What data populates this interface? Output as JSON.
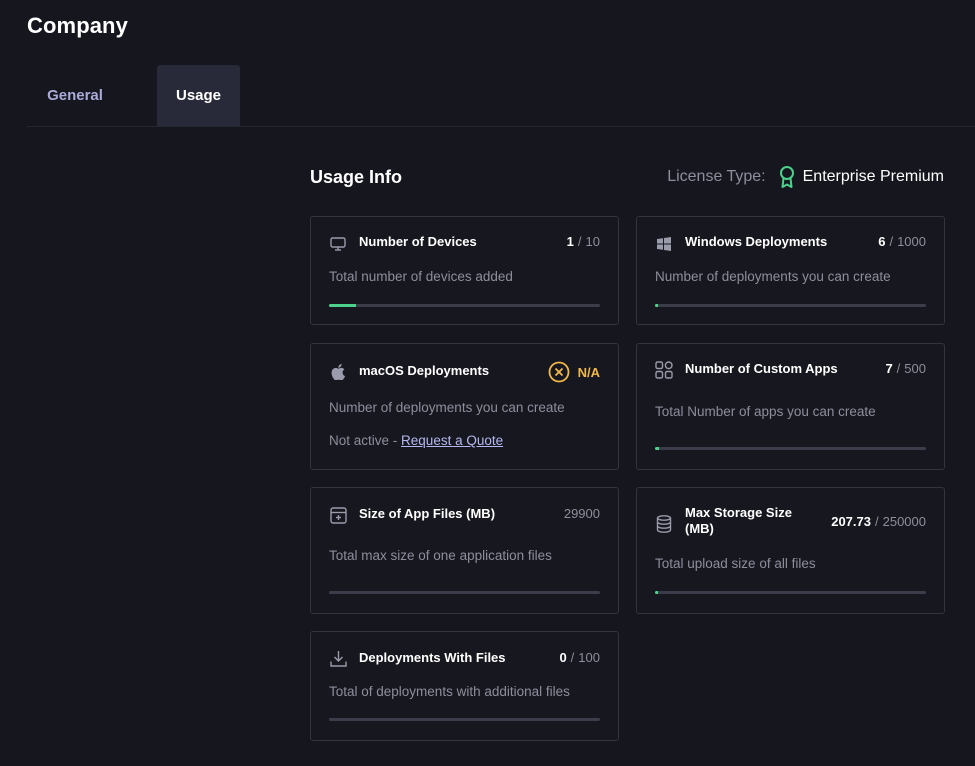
{
  "page": {
    "title": "Company"
  },
  "tabs": [
    {
      "label": "General",
      "active": false
    },
    {
      "label": "Usage",
      "active": true
    }
  ],
  "usage": {
    "title": "Usage Info",
    "license_label": "License Type:",
    "license_value": "Enterprise Premium",
    "license_icon": "award-ribbon-icon"
  },
  "colors": {
    "accent_green": "#4cd28a",
    "warning_amber": "#f1b84a",
    "link": "#b5b8f0"
  },
  "cards": {
    "devices": {
      "title": "Number of Devices",
      "used": "1",
      "sep": "/",
      "limit": "10",
      "desc": "Total number of devices added",
      "progress": 0.1,
      "icon": "monitor-icon"
    },
    "windows": {
      "title": "Windows Deployments",
      "used": "6",
      "sep": "/",
      "limit": "1000",
      "desc": "Number of deployments you can create",
      "progress": 0.006,
      "icon": "windows-icon"
    },
    "macos": {
      "title": "macOS Deployments",
      "status": "N/A",
      "desc": "Number of deployments you can create",
      "not_active": "Not active -",
      "quote_link": "Request a Quote",
      "icon": "apple-icon"
    },
    "custom_apps": {
      "title": "Number of Custom Apps",
      "used": "7",
      "sep": "/",
      "limit": "500",
      "desc": "Total Number of apps you can create",
      "progress": 0.014,
      "icon": "apps-grid-icon"
    },
    "app_files": {
      "title": "Size of App Files (MB)",
      "limit": "29900",
      "desc": "Total max size of one application files",
      "progress": 0,
      "icon": "package-icon"
    },
    "storage": {
      "title": "Max Storage Size (MB)",
      "used": "207.73",
      "sep": "/",
      "limit": "250000",
      "desc": "Total upload size of all files",
      "progress": 0.0008,
      "icon": "database-icon"
    },
    "deploy_files": {
      "title": "Deployments With Files",
      "used": "0",
      "sep": "/",
      "limit": "100",
      "desc": "Total of deployments with additional files",
      "progress": 0,
      "icon": "download-icon"
    }
  }
}
